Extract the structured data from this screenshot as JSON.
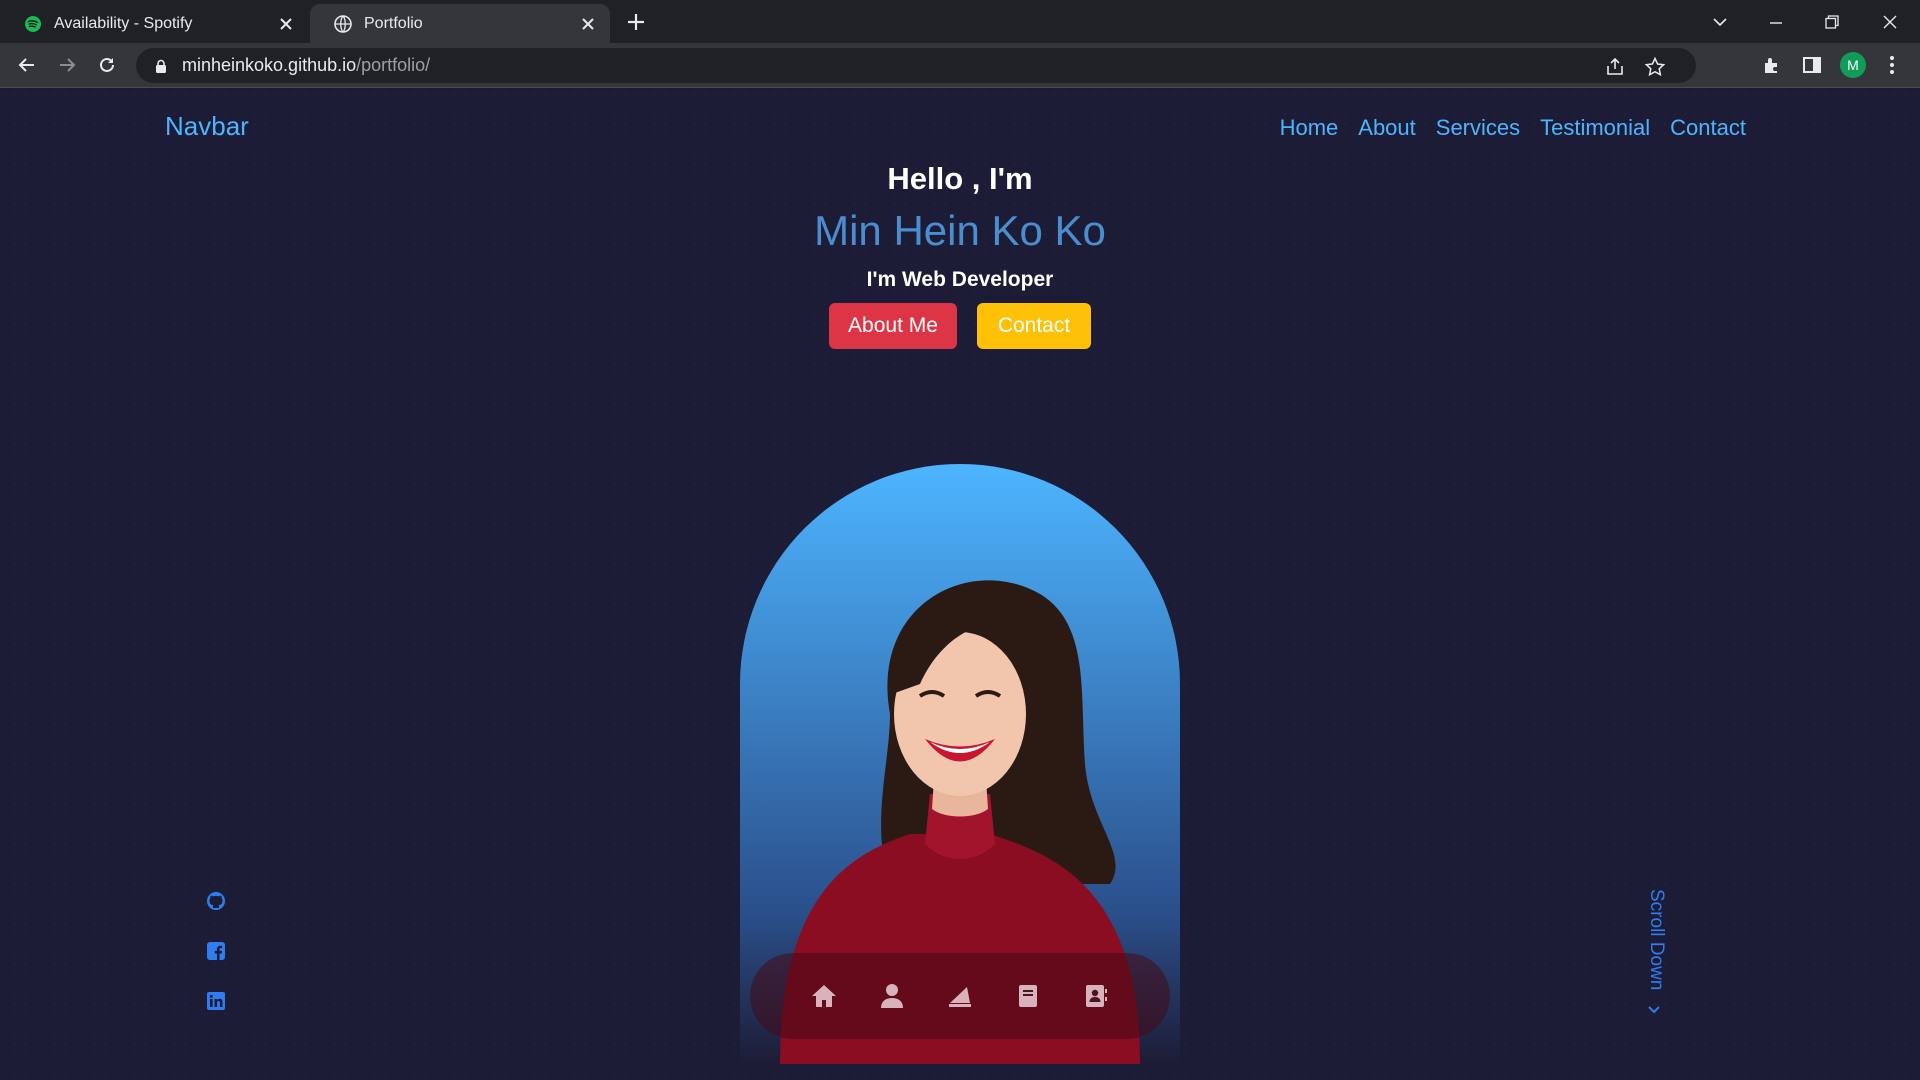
{
  "browser": {
    "tabs": [
      {
        "title": "Availability - Spotify",
        "favicon": "spotify-icon"
      },
      {
        "title": "Portfolio",
        "favicon": "globe-icon"
      }
    ],
    "url_host": "minheinkoko.github.io",
    "url_path": "/portfolio/",
    "profile_initial": "M"
  },
  "navbar": {
    "brand": "Navbar",
    "links": [
      "Home",
      "About",
      "Services",
      "Testimonial",
      "Contact"
    ]
  },
  "hero": {
    "greeting": "Hello , I'm",
    "name": "Min Hein Ko Ko",
    "role": "I'm Web Developer",
    "about_button": "About Me",
    "contact_button": "Contact"
  },
  "dock": {
    "icons": [
      "home-icon",
      "user-icon",
      "services-icon",
      "book-icon",
      "contact-book-icon"
    ]
  },
  "social": {
    "icons": [
      "github-icon",
      "facebook-icon",
      "linkedin-icon"
    ]
  },
  "scroll": {
    "label": "Scroll Down"
  },
  "colors": {
    "accent": "#4db5ff",
    "name": "#4a8ed0",
    "about_button": "#dc3545",
    "contact_button": "#ffc107",
    "background": "#1d1c36"
  }
}
